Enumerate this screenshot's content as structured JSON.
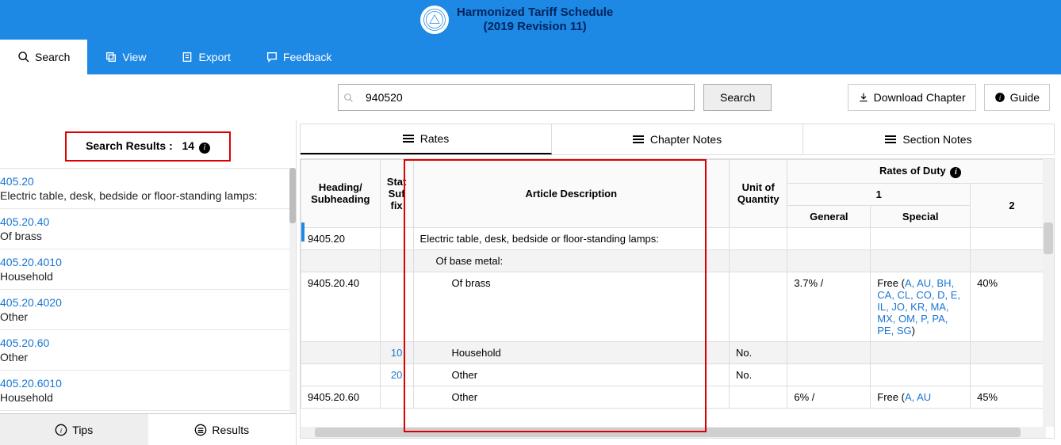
{
  "header": {
    "title_line1": "Harmonized Tariff Schedule",
    "title_line2": "(2019 Revision 11)"
  },
  "nav": {
    "search": "Search",
    "view": "View",
    "export": "Export",
    "feedback": "Feedback"
  },
  "search": {
    "value": "940520",
    "button": "Search"
  },
  "toolbar": {
    "download": "Download Chapter",
    "guide": "Guide"
  },
  "sidebar": {
    "results_label": "Search Results :",
    "results_count": "14",
    "items": [
      {
        "code": "405.20",
        "desc": "Electric table, desk, bedside or floor-standing lamps:"
      },
      {
        "code": "405.20.40",
        "desc": "Of brass"
      },
      {
        "code": "405.20.4010",
        "desc": "Household"
      },
      {
        "code": "405.20.4020",
        "desc": "Other"
      },
      {
        "code": "405.20.60",
        "desc": "Other"
      },
      {
        "code": "405.20.6010",
        "desc": "Household"
      }
    ],
    "bottom_tabs": {
      "tips": "Tips",
      "results": "Results"
    }
  },
  "section_tabs": {
    "rates": "Rates",
    "chapter_notes": "Chapter Notes",
    "section_notes": "Section Notes"
  },
  "table": {
    "head": {
      "heading": "Heading/ Subheading",
      "suffix": "Stat Suf fix",
      "article": "Article Description",
      "unit": "Unit of Quantity",
      "rates": "Rates of Duty",
      "one": "1",
      "general": "General",
      "special": "Special",
      "two": "2"
    },
    "rows": [
      {
        "heading": "9405.20",
        "suffix": "",
        "article": "Electric table, desk, bedside or floor-standing lamps:",
        "indent": 0,
        "unit": "",
        "general": "",
        "special": "",
        "col2": "",
        "sub": false
      },
      {
        "heading": "",
        "suffix": "",
        "article": "Of base metal:",
        "indent": 1,
        "unit": "",
        "general": "",
        "special": "",
        "col2": "",
        "sub": true
      },
      {
        "heading": "9405.20.40",
        "suffix": "",
        "article": "Of brass",
        "indent": 2,
        "unit": "",
        "general": "3.7%  /",
        "special_prefix": "Free (",
        "special_codes": "A, AU, BH, CA, CL, CO, D, E, IL, JO, KR, MA, MX, OM, P, PA, PE, SG",
        "special_suffix": ")",
        "col2": "40%",
        "sub": false
      },
      {
        "heading": "",
        "suffix": "10",
        "article": "Household",
        "indent": 2,
        "unit": "No.",
        "general": "",
        "special": "",
        "col2": "",
        "sub": true
      },
      {
        "heading": "",
        "suffix": "20",
        "article": "Other",
        "indent": 2,
        "unit": "No.",
        "general": "",
        "special": "",
        "col2": "",
        "sub": false
      },
      {
        "heading": "9405.20.60",
        "suffix": "",
        "article": "Other",
        "indent": 2,
        "unit": "",
        "general": "6%  /",
        "special_prefix": "Free (",
        "special_codes": "A, AU",
        "special_suffix": "",
        "col2": "45%",
        "sub": false
      }
    ]
  }
}
